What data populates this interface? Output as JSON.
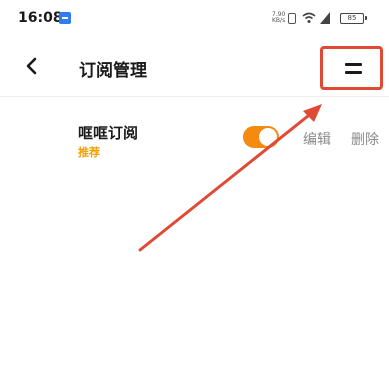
{
  "status_bar": {
    "time": "16:08",
    "net_speed": "7.90 KB/s",
    "battery": "85"
  },
  "header": {
    "title": "订阅管理"
  },
  "subscriptions": [
    {
      "name": "哐哐订阅",
      "tag": "推荐",
      "enabled": true,
      "edit_label": "编辑",
      "delete_label": "删除"
    }
  ],
  "colors": {
    "accent": "#f58a10",
    "tag": "#f5a000",
    "annotation": "#e04a34"
  },
  "icons": [
    "back-icon",
    "menu-icon",
    "wifi-icon",
    "signal-icon",
    "battery-icon",
    "sim-icon"
  ]
}
